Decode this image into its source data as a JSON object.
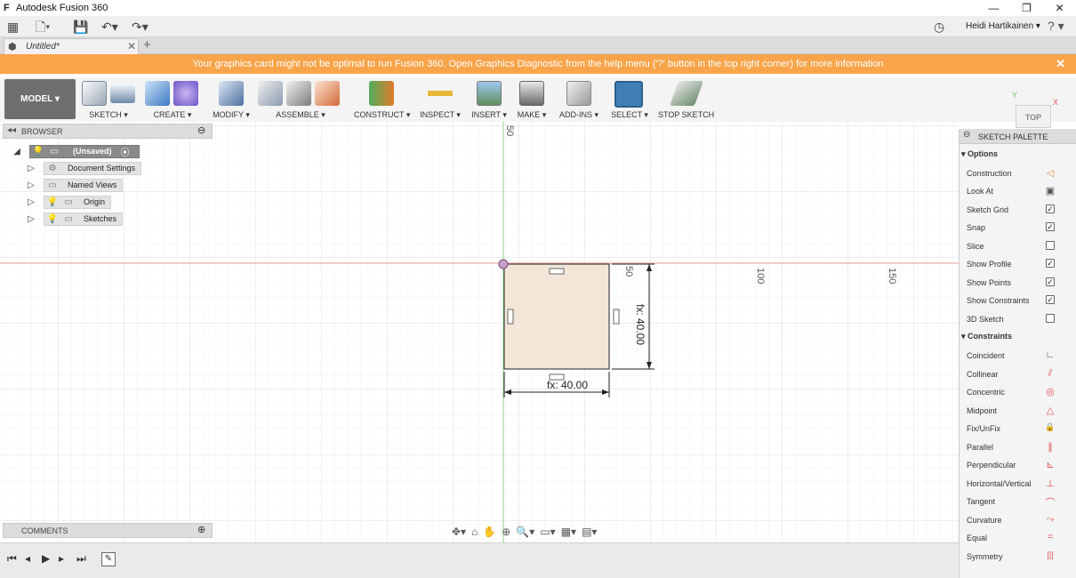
{
  "window": {
    "title": "Autodesk Fusion 360",
    "app_logo": "F",
    "controls": [
      "—",
      "❐",
      "✕"
    ]
  },
  "qat": {
    "user": "Heidi Hartikainen ▾",
    "help": "? ▾",
    "icons": {
      "grid": "▦",
      "file": "🗋▾",
      "save": "💾",
      "undo": "↶▾",
      "redo": "↷▾",
      "clock": "◷"
    }
  },
  "tabs": {
    "doc_name": "Untitled*",
    "close": "✕",
    "new": "+"
  },
  "banner": {
    "text": "Your graphics card might not be optimal to run Fusion 360. Open Graphics Diagnostic from the help menu ('?' button in the top right corner) for more information",
    "close": "✕"
  },
  "toolbar": {
    "model": "MODEL ▾",
    "groups": [
      {
        "label": "SKETCH ▾"
      },
      {
        "label": "CREATE ▾"
      },
      {
        "label": "MODIFY ▾"
      },
      {
        "label": "ASSEMBLE ▾"
      },
      {
        "label": "CONSTRUCT ▾"
      },
      {
        "label": "INSPECT ▾"
      },
      {
        "label": "INSERT ▾"
      },
      {
        "label": "MAKE ▾"
      },
      {
        "label": "ADD-INS ▾"
      },
      {
        "label": "SELECT ▾"
      },
      {
        "label": "STOP SKETCH"
      }
    ]
  },
  "browser": {
    "title": "BROWSER",
    "collapse": "◂◂",
    "minimize": "⊖",
    "items": [
      {
        "label": "(Unsaved)",
        "icon": "lightbulb-icon"
      },
      {
        "label": "Document Settings",
        "icon": "gear-icon"
      },
      {
        "label": "Named Views",
        "icon": "folder-icon"
      },
      {
        "label": "Origin",
        "icon": "folder-icon"
      },
      {
        "label": "Sketches",
        "icon": "folder-icon"
      }
    ]
  },
  "canvas": {
    "ruler_labels": [
      "50",
      "50",
      "100",
      "150"
    ],
    "dim_horizontal": "fx: 40.00",
    "dim_vertical": "fx: 40.00"
  },
  "viewcube": {
    "face": "TOP",
    "x": "X",
    "y": "Y"
  },
  "palette": {
    "title": "SKETCH PALETTE",
    "options_title": "▾ Options",
    "options": [
      {
        "label": "Construction",
        "control": "icon",
        "glyph": "◁"
      },
      {
        "label": "Look At",
        "control": "icon",
        "glyph": "▣"
      },
      {
        "label": "Sketch Grid",
        "control": "check",
        "checked": "✓"
      },
      {
        "label": "Snap",
        "control": "check",
        "checked": "✓"
      },
      {
        "label": "Slice",
        "control": "check",
        "checked": ""
      },
      {
        "label": "Show Profile",
        "control": "check",
        "checked": "✓"
      },
      {
        "label": "Show Points",
        "control": "check",
        "checked": "✓"
      },
      {
        "label": "Show Constraints",
        "control": "check",
        "checked": "✓"
      },
      {
        "label": "3D Sketch",
        "control": "check",
        "checked": ""
      }
    ],
    "constraints_title": "▾ Constraints",
    "constraints": [
      {
        "label": "Coincident",
        "glyph": "∟"
      },
      {
        "label": "Collinear",
        "glyph": "⫽"
      },
      {
        "label": "Concentric",
        "glyph": "◎"
      },
      {
        "label": "Midpoint",
        "glyph": "△"
      },
      {
        "label": "Fix/UnFix",
        "glyph": "🔒"
      },
      {
        "label": "Parallel",
        "glyph": "∥"
      },
      {
        "label": "Perpendicular",
        "glyph": "⊾"
      },
      {
        "label": "Horizontal/Vertical",
        "glyph": "⊥"
      },
      {
        "label": "Tangent",
        "glyph": "⌒"
      },
      {
        "label": "Curvature",
        "glyph": "⤳"
      },
      {
        "label": "Equal",
        "glyph": "="
      },
      {
        "label": "Symmetry",
        "glyph": "[|]"
      }
    ]
  },
  "comments": {
    "title": "COMMENTS",
    "add": "⊕"
  },
  "navbar": [
    "✥▾",
    "⌂",
    "✋",
    "⊕",
    "🔍▾",
    "▭▾",
    "▦▾",
    "▤▾"
  ],
  "timeline": {
    "controls": [
      "⏮",
      "◂",
      "▶",
      "▸",
      "⏭"
    ],
    "feature": "✎"
  }
}
